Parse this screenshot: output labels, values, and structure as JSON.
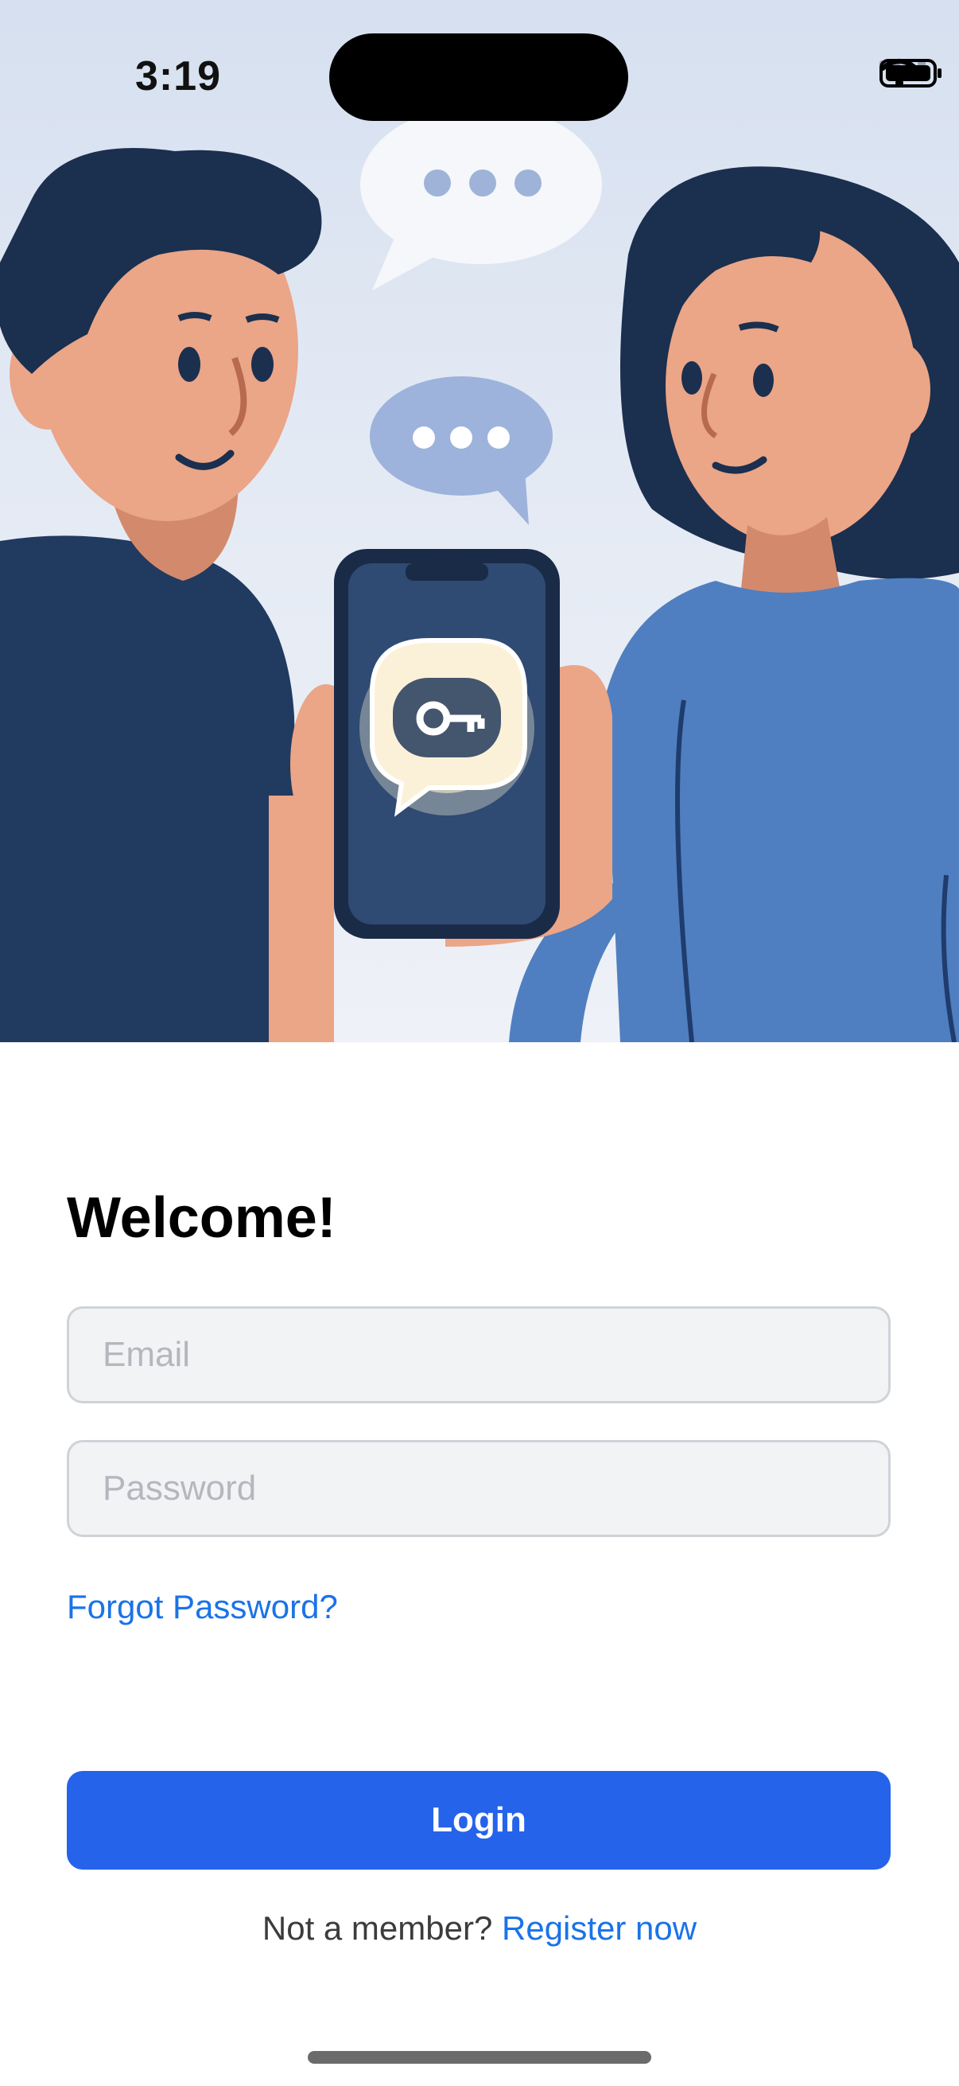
{
  "status_bar": {
    "time": "3:19",
    "icons": [
      "signal-icon",
      "wifi-icon",
      "battery-icon"
    ]
  },
  "hero": {
    "description_icons": [
      "man-illustration",
      "woman-illustration",
      "phone-illustration",
      "key-chat-icon",
      "chat-bubble-icon"
    ]
  },
  "login": {
    "title": "Welcome!",
    "email_placeholder": "Email",
    "password_placeholder": "Password",
    "forgot_label": "Forgot Password?",
    "login_label": "Login",
    "register_prompt": "Not a member?",
    "register_link": "Register now"
  },
  "colors": {
    "accent": "#2563eb",
    "link": "#1a73e8",
    "field_bg": "#f2f3f5"
  }
}
